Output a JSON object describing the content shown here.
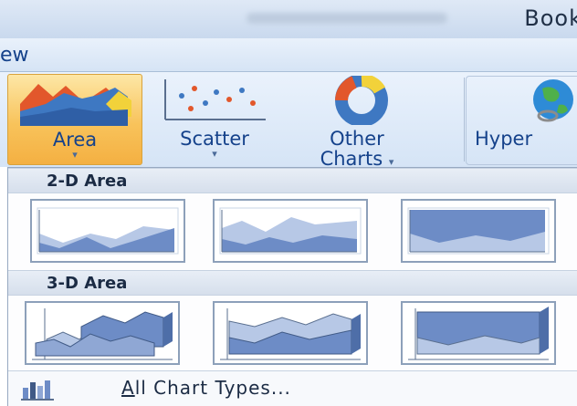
{
  "window": {
    "title_fragment": "Book"
  },
  "tabs": {
    "visible_fragment": "ew"
  },
  "ribbon": {
    "area_label": "Area",
    "scatter_label": "Scatter",
    "other_label_line1": "Other",
    "other_label_line2": "Charts",
    "hyperlink_label": "Hyper",
    "caret": "▾"
  },
  "dropdown": {
    "section_2d": "2-D Area",
    "section_3d": "3-D Area",
    "footer": {
      "mnemonic": "A",
      "rest": "ll Chart Types..."
    }
  },
  "icons": {
    "area": "area-chart-icon",
    "scatter": "scatter-chart-icon",
    "other": "doughnut-chart-icon",
    "hyperlink": "globe-link-icon",
    "all_chart_types": "bar-chart-icon"
  },
  "colors": {
    "accent": "#15428b",
    "selected_button": "#f8c35b",
    "tile_fill": "#8fa7d4",
    "tile_border": "#8da0ba"
  }
}
